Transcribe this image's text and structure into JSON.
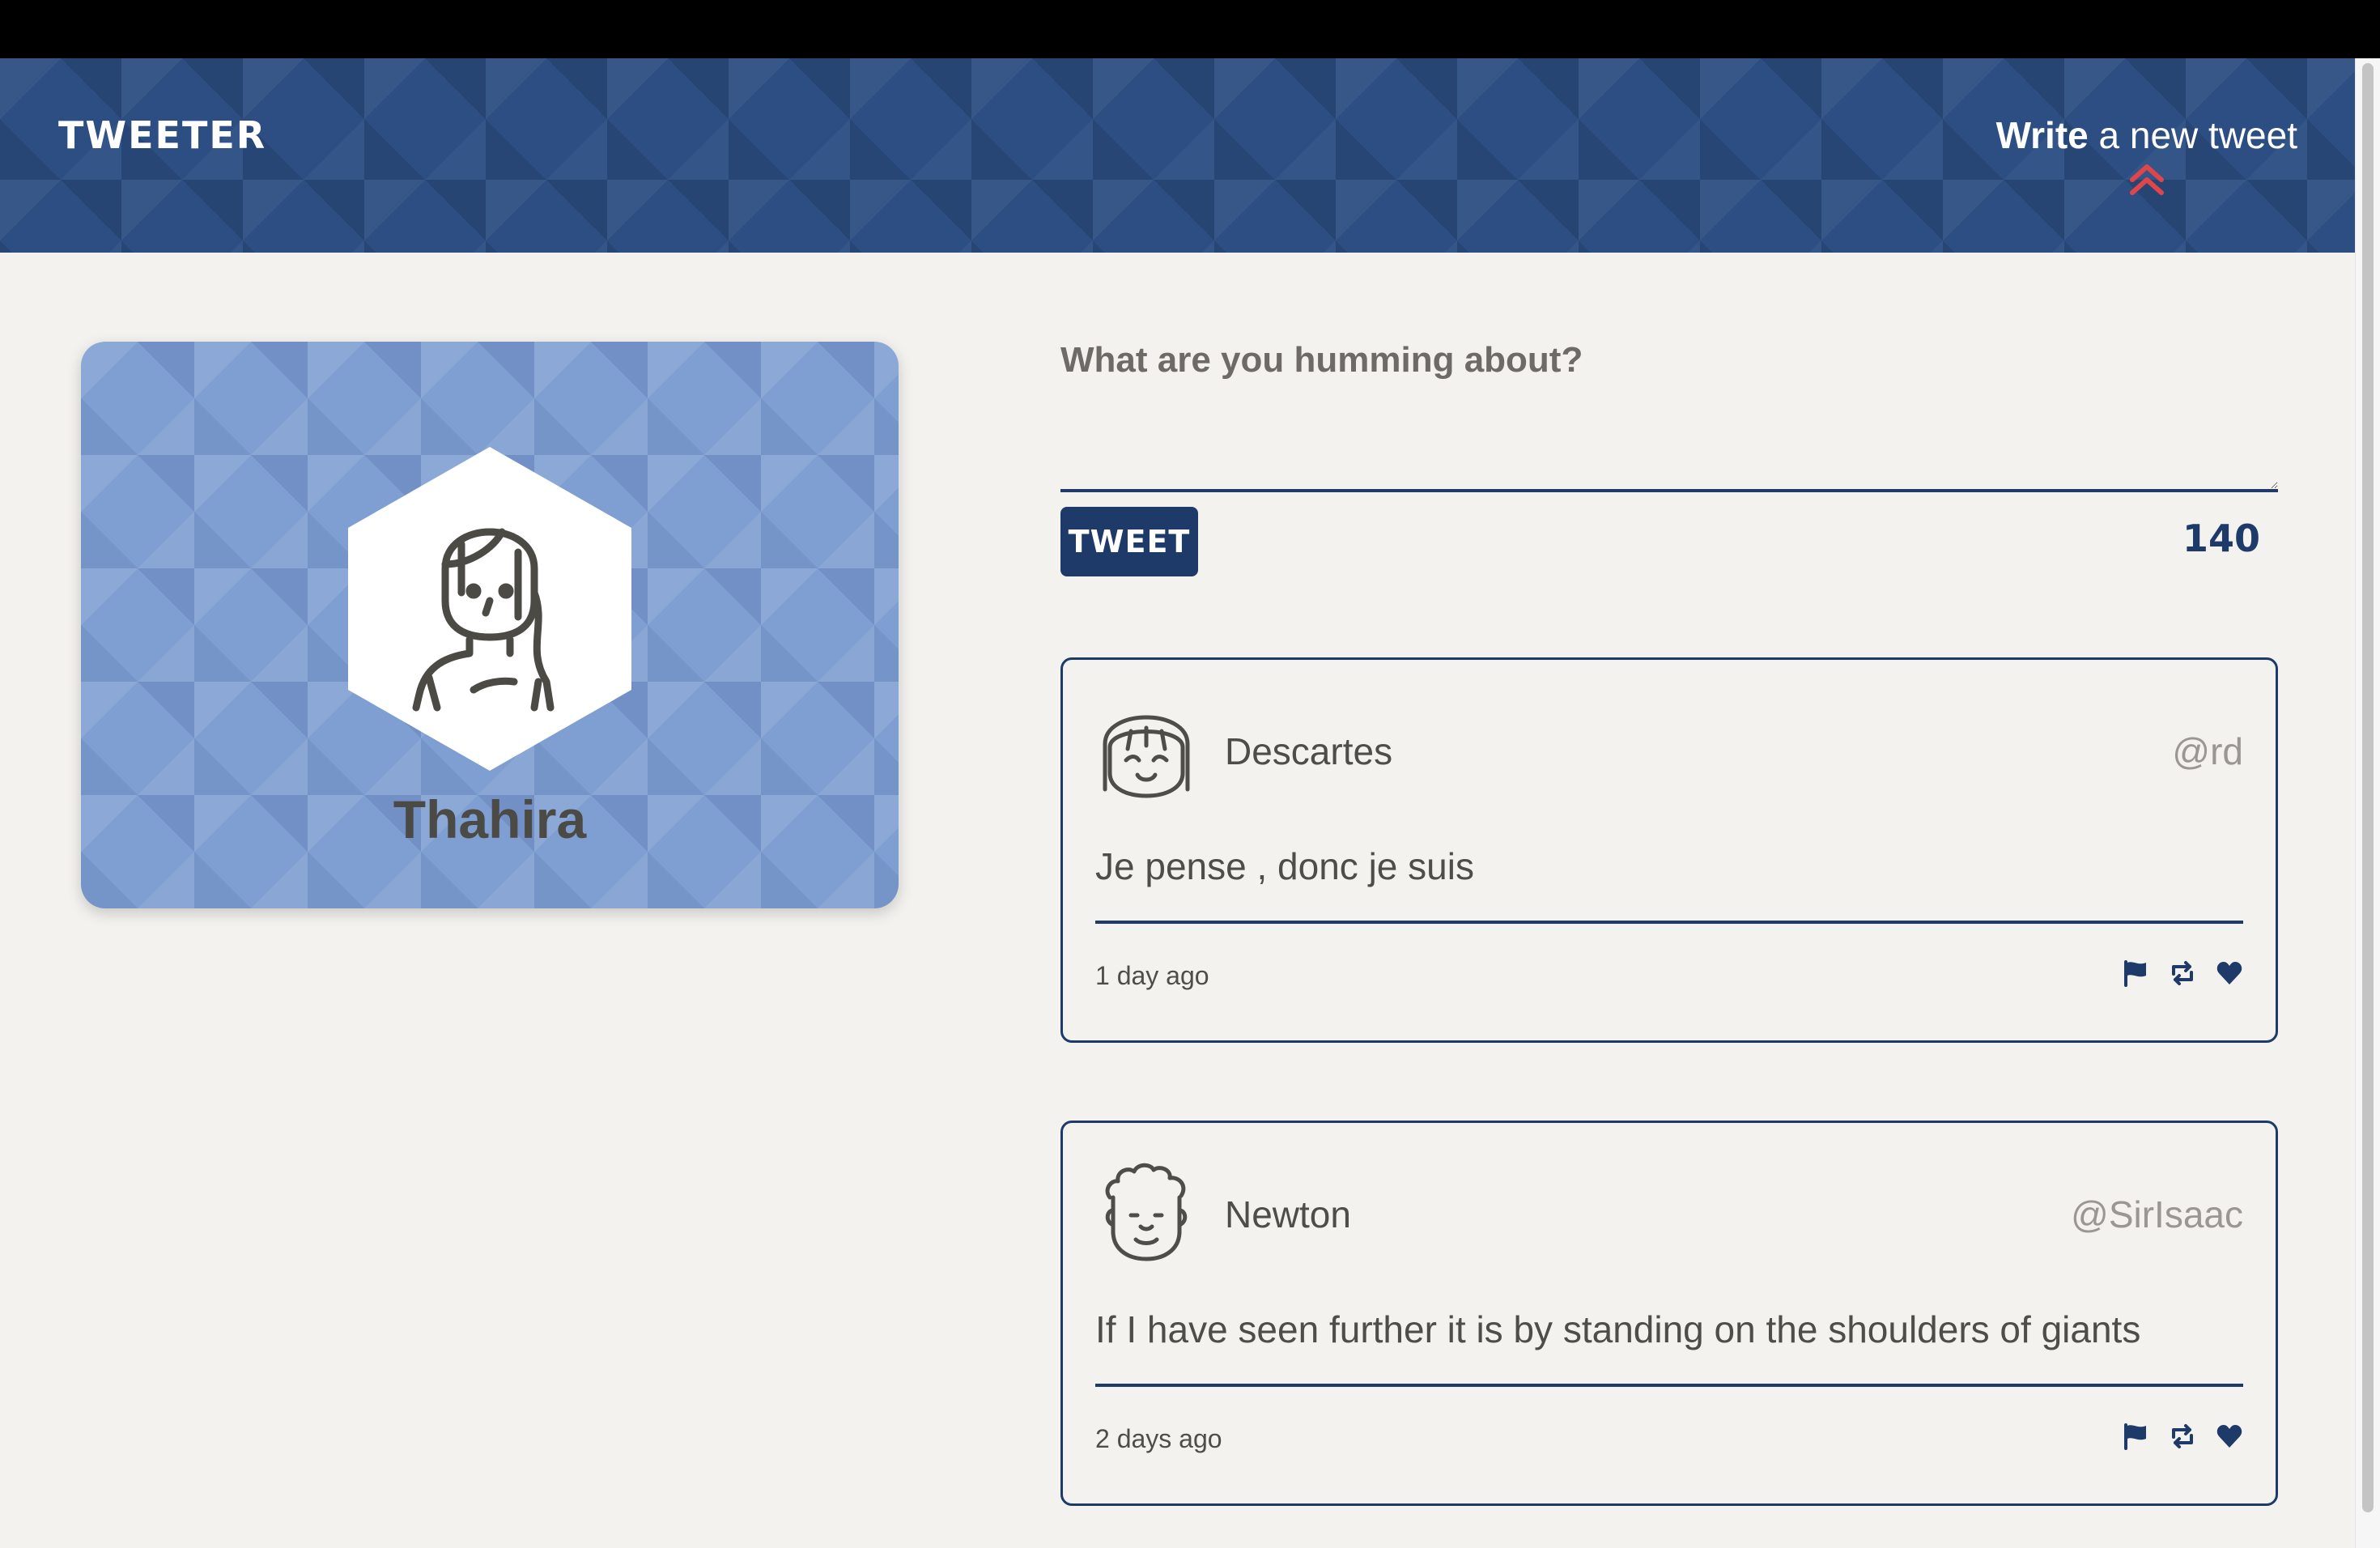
{
  "nav": {
    "logo": "TWEETER",
    "compose_toggle_strong": "Write",
    "compose_toggle_rest": " a new tweet"
  },
  "profile": {
    "name": "Thahira"
  },
  "composer": {
    "label": "What are you humming about?",
    "value": "",
    "button_label": "TWEET",
    "counter": "140"
  },
  "tweets": [
    {
      "name": "Descartes",
      "handle": "@rd",
      "text": "Je pense , donc je suis",
      "time": "1 day ago"
    },
    {
      "name": "Newton",
      "handle": "@SirIsaac",
      "text": "If I have seen further it is by standing on the shoulders of giants",
      "time": "2 days ago"
    }
  ],
  "colors": {
    "navy": "#1e3a69",
    "header_blue": "#2c4e82",
    "card_blue": "#7f9ed1",
    "page_bg": "#f4f2ee",
    "accent_red": "#e0454a"
  },
  "icons": {
    "compose_toggle": "double-chevron-up-icon",
    "flag": "flag-icon",
    "retweet": "retweet-icon",
    "like": "heart-icon"
  }
}
